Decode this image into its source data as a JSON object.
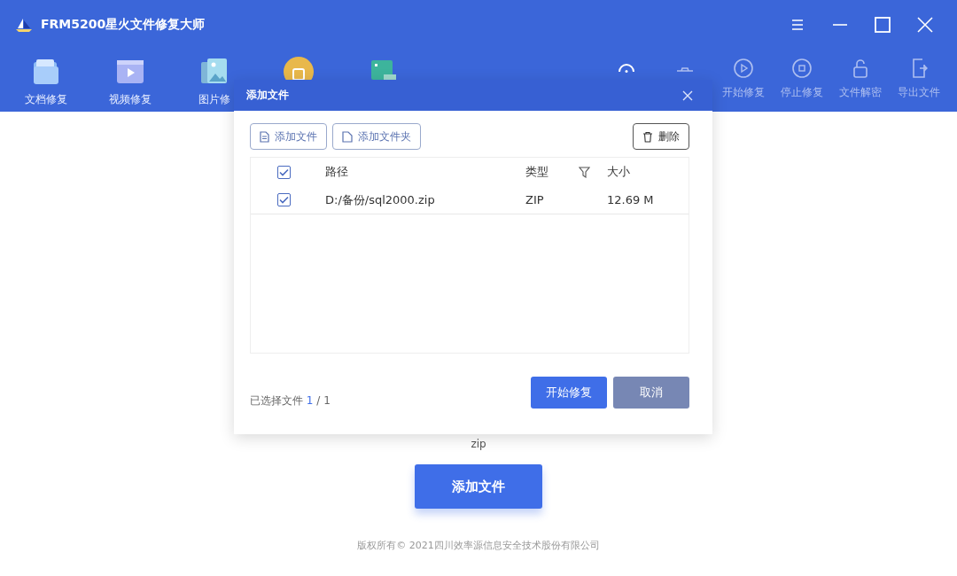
{
  "window": {
    "title": "FRM5200星火文件修复大师"
  },
  "toolbar": {
    "left": [
      {
        "kind": "docs",
        "label": "文档修复"
      },
      {
        "kind": "video",
        "label": "视频修复"
      },
      {
        "kind": "image",
        "label": "图片修"
      },
      {
        "kind": "lock"
      },
      {
        "kind": "board"
      }
    ],
    "right": [
      {
        "kind": "gauge"
      },
      {
        "kind": "tray"
      },
      {
        "kind": "play",
        "label": "开始修复"
      },
      {
        "kind": "stop",
        "label": "停止修复"
      },
      {
        "kind": "unlock",
        "label": "文件解密"
      },
      {
        "kind": "export",
        "label": "导出文件"
      }
    ]
  },
  "main": {
    "hint": "zip",
    "add_button": "添加文件",
    "footer": "版权所有© 2021四川效率源信息安全技术股份有限公司"
  },
  "dialog": {
    "title": "添加文件",
    "add_file": "添加文件",
    "add_folder": "添加文件夹",
    "delete": "删除",
    "table": {
      "all_checked": true,
      "columns": [
        "路径",
        "类型",
        "大小"
      ],
      "rows": [
        {
          "checked": true,
          "path": "D:/备份/sql2000.zip",
          "type": "ZIP",
          "size": "12.69 M"
        }
      ]
    },
    "selected_label": "已选择文件",
    "selected_count": "1",
    "total_count": "/ 1",
    "start": "开始修复",
    "cancel": "取消"
  }
}
